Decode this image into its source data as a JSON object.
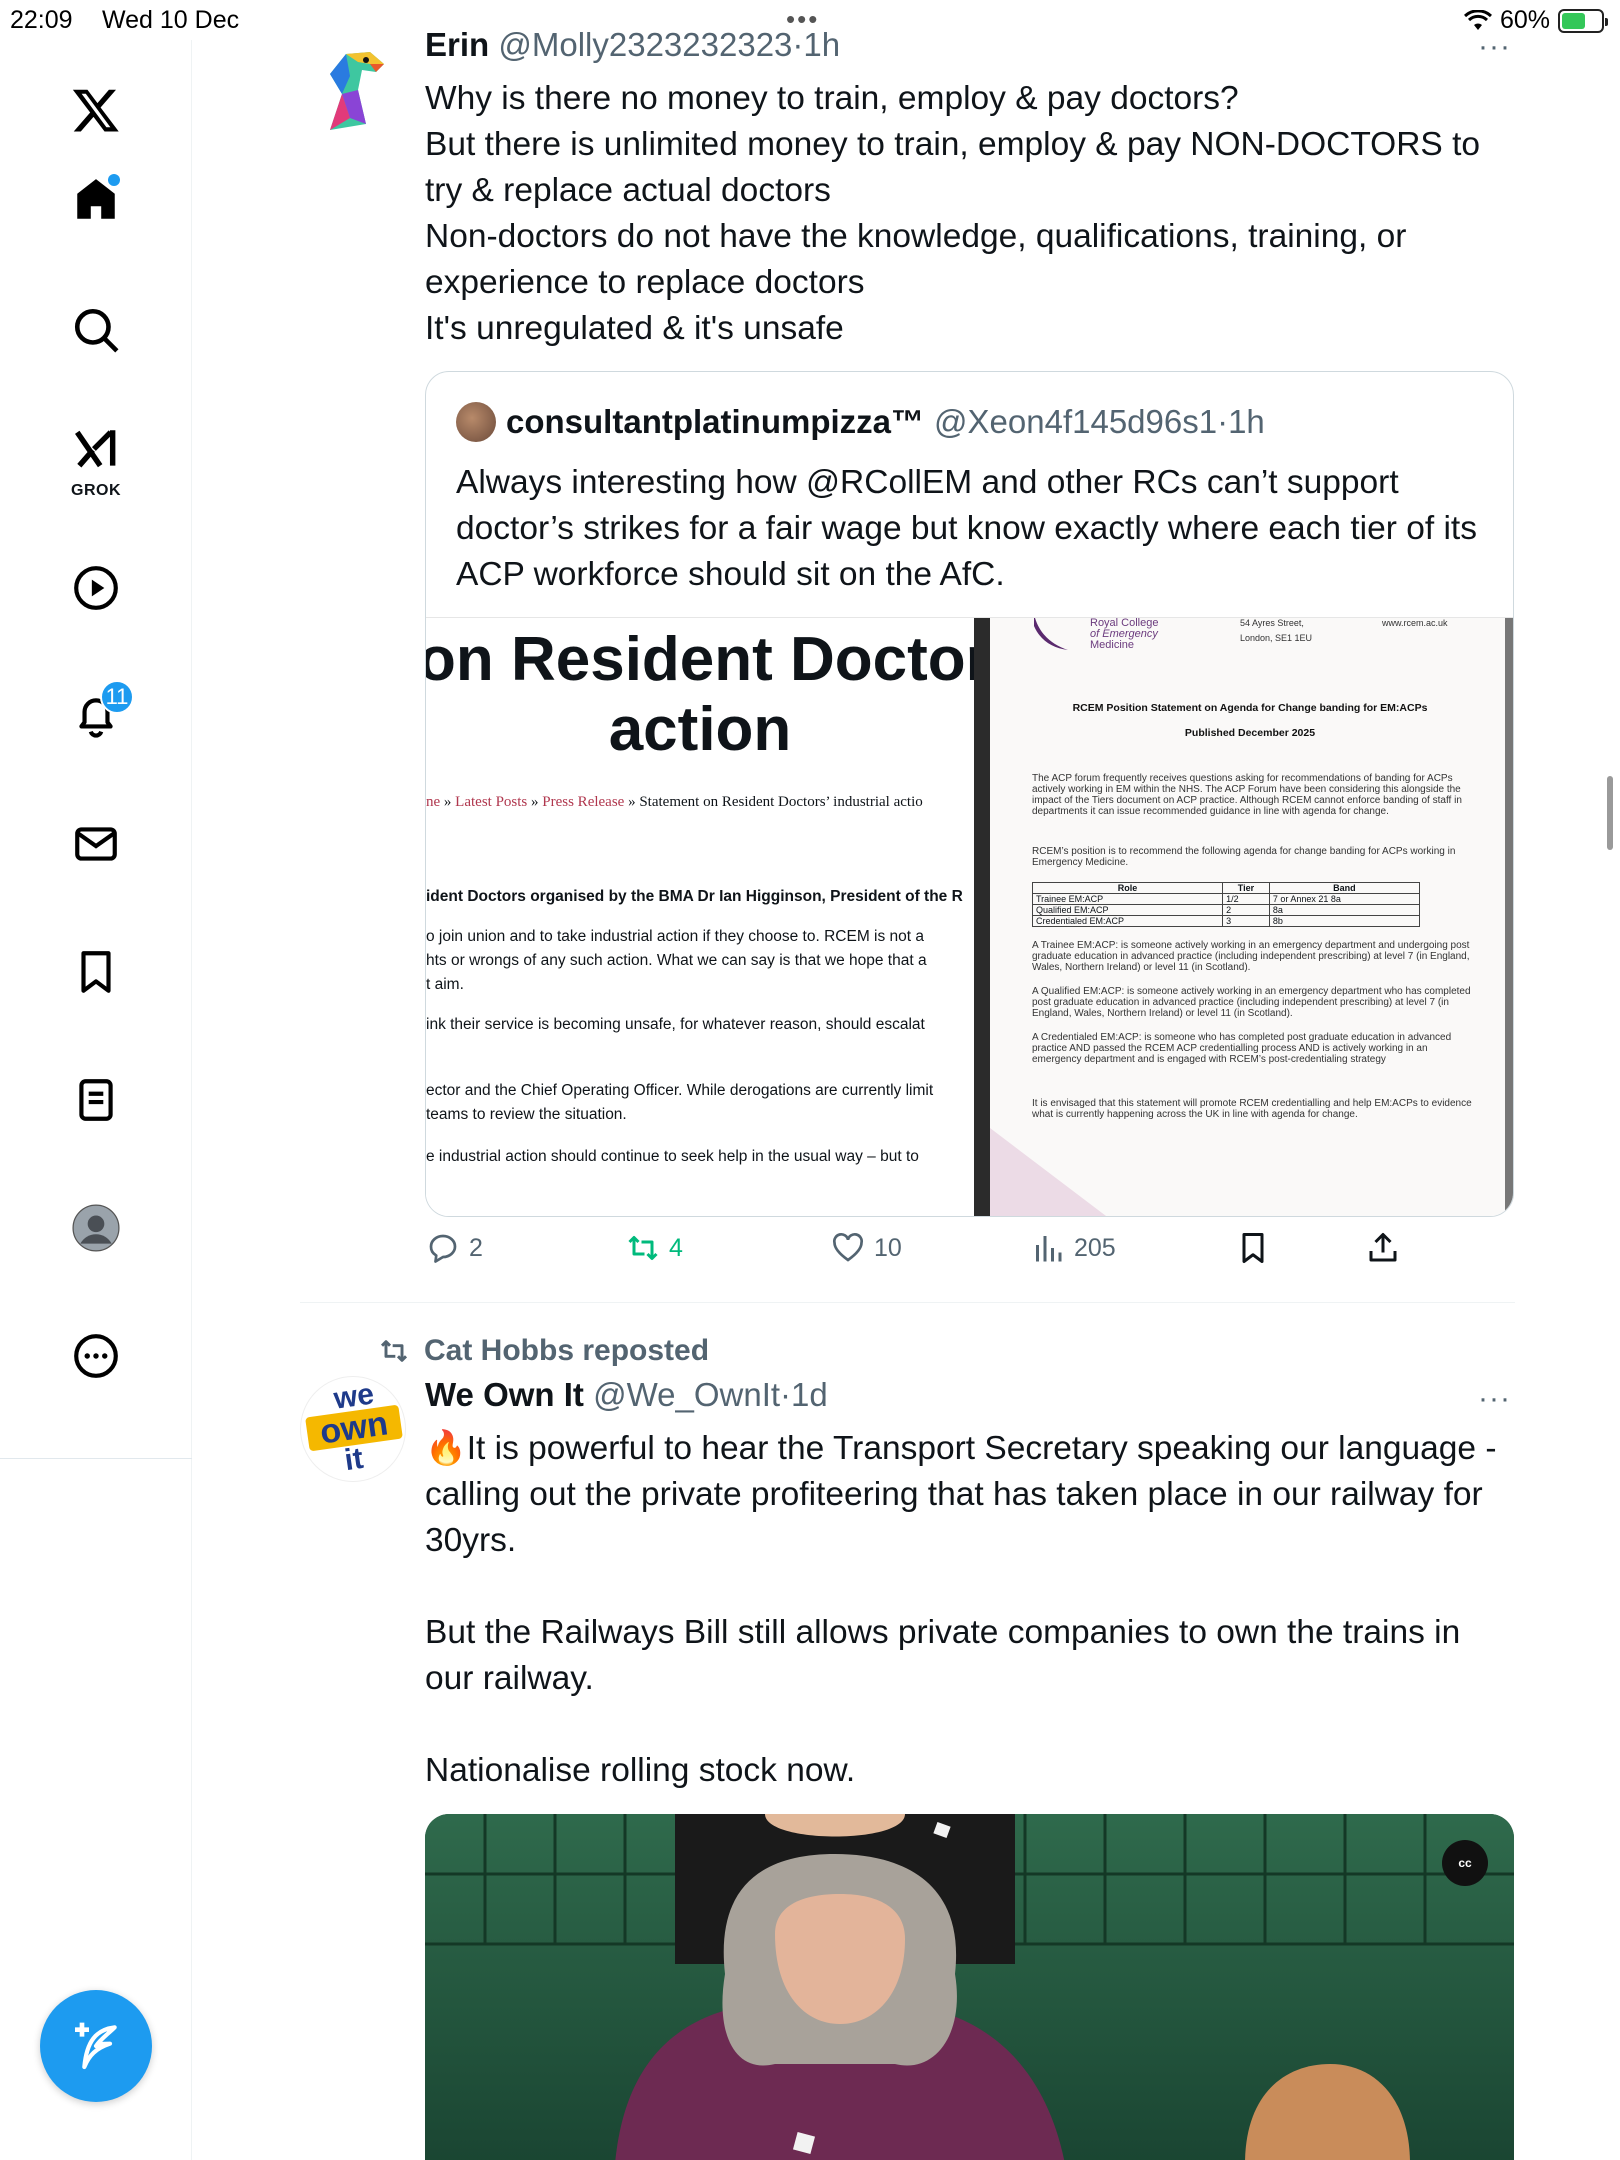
{
  "status_bar": {
    "time": "22:09",
    "date": "Wed 10 Dec",
    "battery_percent": "60%",
    "battery_level": 0.6,
    "dots": "•••"
  },
  "sidebar": {
    "items": [
      {
        "name": "x-logo",
        "icon": "x-logo-icon"
      },
      {
        "name": "home",
        "icon": "home-icon",
        "has_dot": true
      },
      {
        "name": "search",
        "icon": "search-icon"
      },
      {
        "name": "grok",
        "icon": "grok-icon",
        "label": "GROK"
      },
      {
        "name": "videos",
        "icon": "play-icon"
      },
      {
        "name": "notifications",
        "icon": "bell-icon",
        "badge": "11"
      },
      {
        "name": "messages",
        "icon": "mail-icon"
      },
      {
        "name": "bookmarks",
        "icon": "bookmark-icon"
      },
      {
        "name": "lists",
        "icon": "list-icon"
      },
      {
        "name": "profile",
        "icon": "avatar-icon"
      },
      {
        "name": "more",
        "icon": "more-circle-icon"
      }
    ],
    "compose_icon": "compose-icon"
  },
  "tweet1": {
    "name": "Erin",
    "handle": "@Molly2323232323",
    "time": "1h",
    "more": "···",
    "text": [
      "Why is there no money to train, employ & pay doctors?",
      "But there is unlimited money to train, employ & pay NON-DOCTORS to try & replace actual doctors",
      "Non-doctors do not have the knowledge, qualifications, training, or experience to replace doctors",
      "It's unregulated & it's unsafe"
    ],
    "quote": {
      "name": "consultantplatinumpizza™",
      "handle": "@Xeon4f145d96s1",
      "time": "1h",
      "text": "Always interesting how @RCollEM and other RCs can’t support doctor’s strikes for a fair wage but know exactly where each tier of its ACP workforce should sit on the AfC.",
      "media": {
        "left": {
          "headline1": "on Resident Doctors",
          "headline2": "action",
          "crumb_home": "ne",
          "crumb_sep": " » ",
          "crumb_latest": "Latest Posts",
          "crumb_press": "Press Release",
          "crumb_current": "Statement on Resident Doctors’ industrial actio",
          "lines": [
            "ident Doctors organised by the BMA Dr Ian Higginson, President of the R",
            "o join union and to take industrial action if they choose to. RCEM is not a",
            "hts or wrongs of any such action. What we can say is that we hope that a",
            "t aim.",
            "ink their service is becoming unsafe, for whatever reason, should escalat",
            "ector and the Chief Operating Officer. While derogations are currently limit",
            "teams to review the situation.",
            "e industrial action should continue to seek help in the usual way – but to"
          ]
        },
        "right": {
          "org_line1": "Royal College",
          "org_line2": "of Emergency",
          "org_line3": "Medicine",
          "address1": "54 Ayres Street,",
          "address2": "London, SE1 1EU",
          "website": "www.rcem.ac.uk",
          "title": "RCEM Position Statement on Agenda for Change banding for EM:ACPs",
          "published": "Published December 2025",
          "para1": "The ACP forum frequently receives questions asking for recommendations of banding for ACPs actively working in EM within the NHS. The ACP Forum have been considering this alongside the impact of the Tiers document on ACP practice. Although RCEM cannot enforce banding of staff in departments it can issue recommended guidance in line with agenda for change.",
          "para2": "RCEM’s position is to recommend the following agenda for change banding for ACPs working in Emergency Medicine.",
          "table_headers": [
            "Role",
            "Tier",
            "Band"
          ],
          "table_rows": [
            [
              "Trainee EM:ACP",
              "1/2",
              "7 or Annex 21 8a"
            ],
            [
              "Qualified EM:ACP",
              "2",
              "8a"
            ],
            [
              "Credentialed EM:ACP",
              "3",
              "8b"
            ]
          ],
          "def1": "A Trainee EM:ACP: is someone actively working in an emergency department and undergoing post graduate education in advanced practice (including independent prescribing) at level 7 (in England, Wales, Northern Ireland) or level 11 (in Scotland).",
          "def2": "A Qualified EM:ACP: is someone actively working in an emergency department who has completed post graduate education in advanced practice (including independent prescribing) at level 7 (in England, Wales, Northern Ireland) or level 11 (in Scotland).",
          "def3": "A Credentialed EM:ACP: is someone who has completed post graduate education in advanced practice AND passed the RCEM ACP credentialling process AND is actively working in an emergency department and is engaged with RCEM’s post-credentialing strategy",
          "closing": "It is envisaged that this statement will promote RCEM credentialling and help EM:ACPs to evidence what is currently happening across the UK in line with agenda for change."
        }
      }
    },
    "actions": {
      "replies": "2",
      "reposts": "4",
      "likes": "10",
      "views": "205"
    }
  },
  "tweet2": {
    "repost_label": "Cat Hobbs reposted",
    "name": "We Own It",
    "handle": "@We_OwnIt",
    "time": "1d",
    "more": "···",
    "avatar_text": [
      "we",
      "own",
      "it"
    ],
    "emoji": "🔥",
    "text_p1": "It is powerful to hear the Transport Secretary speaking our language - calling out the private profiteering that has taken place in our railway for 30yrs.",
    "text_p2": "But the Railways Bill still allows private companies to own the trains in our railway.",
    "text_p3": "Nationalise rolling stock now.",
    "video_cc": "cc"
  },
  "colors": {
    "accent": "#1d9bf0",
    "repost_green": "#00ba7c",
    "text_secondary": "#536471",
    "crumb_link": "#b0374e"
  }
}
